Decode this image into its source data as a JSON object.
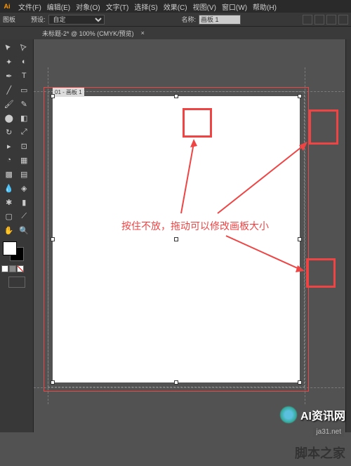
{
  "menubar": {
    "items": [
      "文件(F)",
      "编辑(E)",
      "对象(O)",
      "文字(T)",
      "选择(S)",
      "效果(C)",
      "视图(V)",
      "窗口(W)",
      "帮助(H)"
    ]
  },
  "controlbar": {
    "label1": "图板",
    "preset_label": "预设:",
    "preset_value": "自定",
    "name_label": "名称:",
    "name_value": "画板 1"
  },
  "doc_tab": {
    "title": "未标题-2* @ 100% (CMYK/预览)"
  },
  "artboard": {
    "label": "01 - 画板 1"
  },
  "annotation": "按住不放，拖动可以修改画板大小",
  "watermarks": {
    "wm1": "AI资讯网",
    "wm2": "ja31.net",
    "wm3": "脚本之家"
  },
  "colors": {
    "red": "#ef4444",
    "panel": "#383838",
    "canvas": "#525252"
  }
}
